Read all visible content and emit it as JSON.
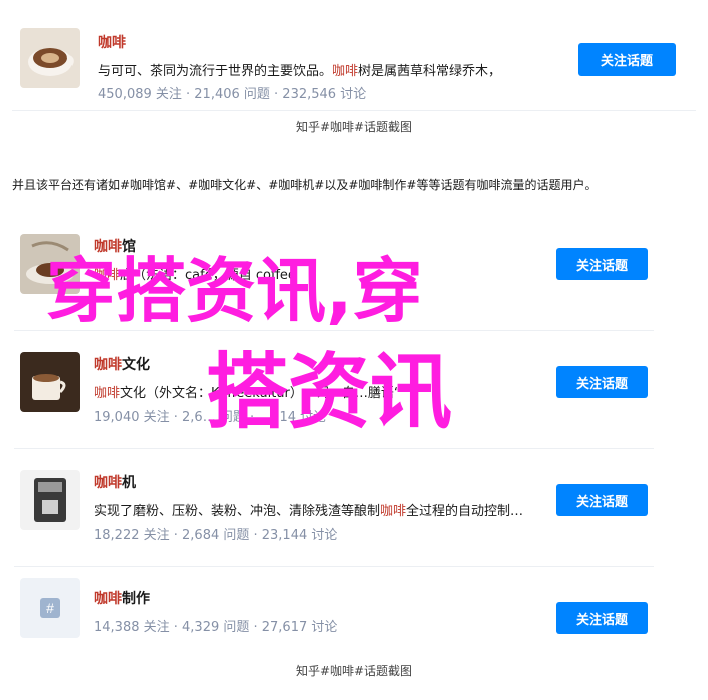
{
  "top_card": {
    "title": "咖啡",
    "desc_prefix": "与可可、茶同为流行于世界的主要饮品。",
    "desc_hl": "咖啡",
    "desc_suffix": "树是属茜草科常绿乔木，",
    "meta": "450,089 关注 · 21,406 问题 · 232,546 讨论",
    "button": "关注话题"
  },
  "top_caption": "知乎#咖啡#话题截图",
  "paragraph": "并且该平台还有诸如#咖啡馆#、#咖啡文化#、#咖啡机#以及#咖啡制作#等等话题有咖啡流量的话题用户。",
  "topics": [
    {
      "title_hl": "咖啡",
      "title_rest": "馆",
      "desc_hl": "咖啡",
      "desc_rest": "店（法语：café，源自 coffee",
      "meta": "",
      "button": "关注话题",
      "icon": "coffee-shop-icon"
    },
    {
      "title_hl": "咖啡",
      "title_rest": "文化",
      "desc_hl": "咖啡",
      "desc_rest": "文化（外文名：Kaffeekultur）一词，自…膳语“",
      "meta": "19,040 关注 · 2,6… 问题 · …714 讨论",
      "button": "关注话题",
      "icon": "coffee-culture-icon"
    },
    {
      "title_hl": "咖啡",
      "title_rest": "机",
      "desc_hl_prefix": "实现了磨粉、压粉、装粉、冲泡、清除残渣等酿制",
      "desc_hl": "咖啡",
      "desc_rest": "全过程的自动控制…",
      "meta": "18,222 关注 · 2,684 问题 · 23,144 讨论",
      "button": "关注话题",
      "icon": "coffee-machine-icon"
    },
    {
      "title_hl": "咖啡",
      "title_rest": "制作",
      "desc_hl": "",
      "desc_rest": "",
      "meta": "14,388 关注 · 4,329 问题 · 27,617 讨论",
      "button": "关注话题",
      "icon": "hashtag-icon"
    }
  ],
  "bottom_caption": "知乎#咖啡#话题截图",
  "watermark": {
    "line1": "穿搭资讯,穿",
    "line2": "搭资讯",
    "color": "#ff1de0"
  },
  "colors": {
    "accent": "#c0392b",
    "button": "#0084ff",
    "meta": "#8590a6"
  }
}
